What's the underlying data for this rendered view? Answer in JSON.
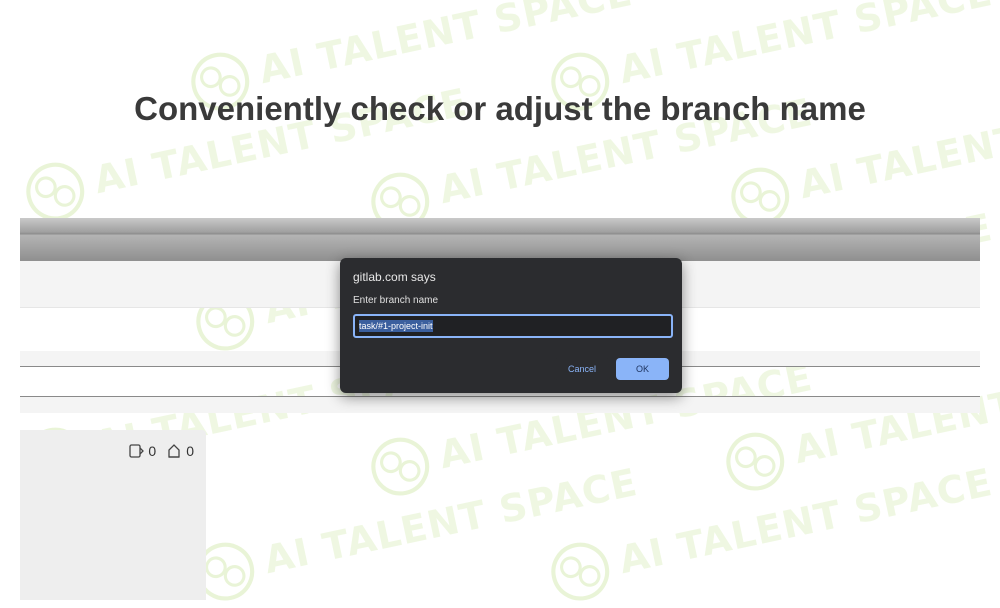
{
  "heading": "Conveniently check or adjust the branch name",
  "watermark": "AI TALENT SPACE",
  "dialog": {
    "title": "gitlab.com says",
    "message": "Enter branch name",
    "input_value": "task/#1-project-init",
    "cancel_label": "Cancel",
    "ok_label": "OK"
  },
  "panel": {
    "mr_count": "0",
    "issue_count": "0"
  },
  "colors": {
    "accent": "#8ab4f8",
    "dialog_bg": "#2b2c2f",
    "heading": "#3a3a3a"
  }
}
